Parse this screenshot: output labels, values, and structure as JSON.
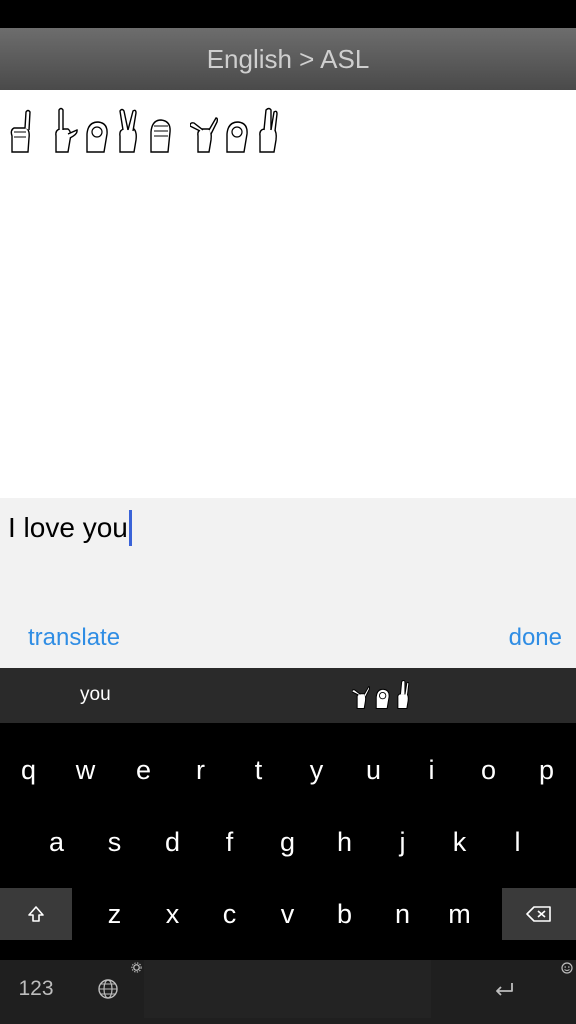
{
  "nav": {
    "title": "English > ASL"
  },
  "input": {
    "value": "I love you"
  },
  "actions": {
    "translate_label": "translate",
    "done_label": "done"
  },
  "suggestion": {
    "word": "you"
  },
  "keyboard": {
    "row1": [
      "q",
      "w",
      "e",
      "r",
      "t",
      "y",
      "u",
      "i",
      "o",
      "p"
    ],
    "row2": [
      "a",
      "s",
      "d",
      "f",
      "g",
      "h",
      "j",
      "k",
      "l"
    ],
    "row3": [
      "z",
      "x",
      "c",
      "v",
      "b",
      "n",
      "m"
    ],
    "numbers_label": "123",
    "icons": {
      "shift": "shift-icon",
      "delete": "delete-icon",
      "globe": "globe-icon",
      "return": "return-icon",
      "settings": "gear-icon",
      "emoji": "emoji-icon"
    }
  },
  "colors": {
    "accent": "#2f8de4",
    "caret": "#3a63d8",
    "nav_bg": "#5a5a5a",
    "keyboard_bg": "#000000"
  }
}
